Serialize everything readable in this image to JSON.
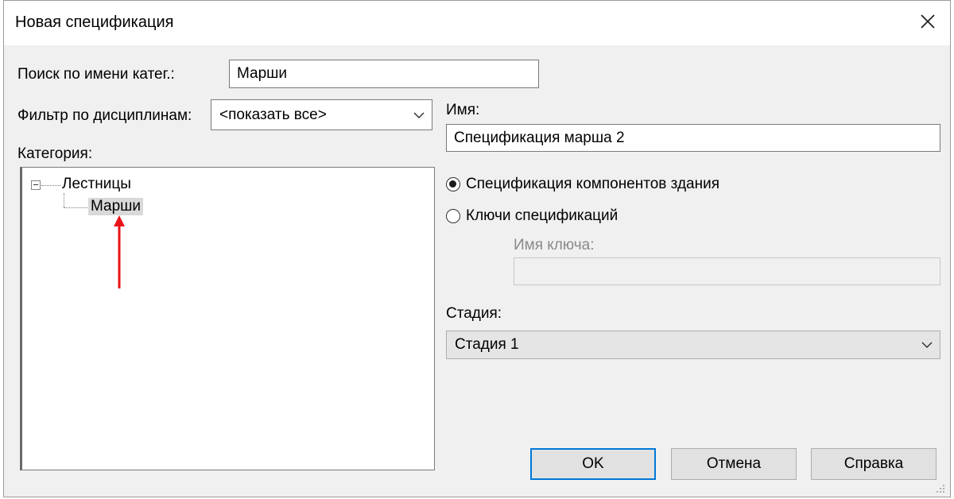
{
  "dialog": {
    "title": "Новая спецификация"
  },
  "search": {
    "label": "Поиск по имени катег.:",
    "value": "Марши"
  },
  "filter": {
    "label": "Фильтр по дисциплинам:",
    "selected": "<показать все>"
  },
  "category": {
    "label": "Категория:",
    "tree": {
      "parent": "Лестницы",
      "child": "Марши"
    }
  },
  "name": {
    "label": "Имя:",
    "value": "Спецификация марша 2"
  },
  "type_options": {
    "building_components": "Спецификация компонентов здания",
    "schedule_keys": "Ключи спецификаций",
    "selected": "building_components"
  },
  "key_name": {
    "label": "Имя ключа:",
    "value": ""
  },
  "phase": {
    "label": "Стадия:",
    "selected": "Стадия 1"
  },
  "buttons": {
    "ok": "OK",
    "cancel": "Отмена",
    "help": "Справка"
  },
  "colors": {
    "accent": "#0078d7",
    "annotation_arrow": "#e8141a"
  }
}
